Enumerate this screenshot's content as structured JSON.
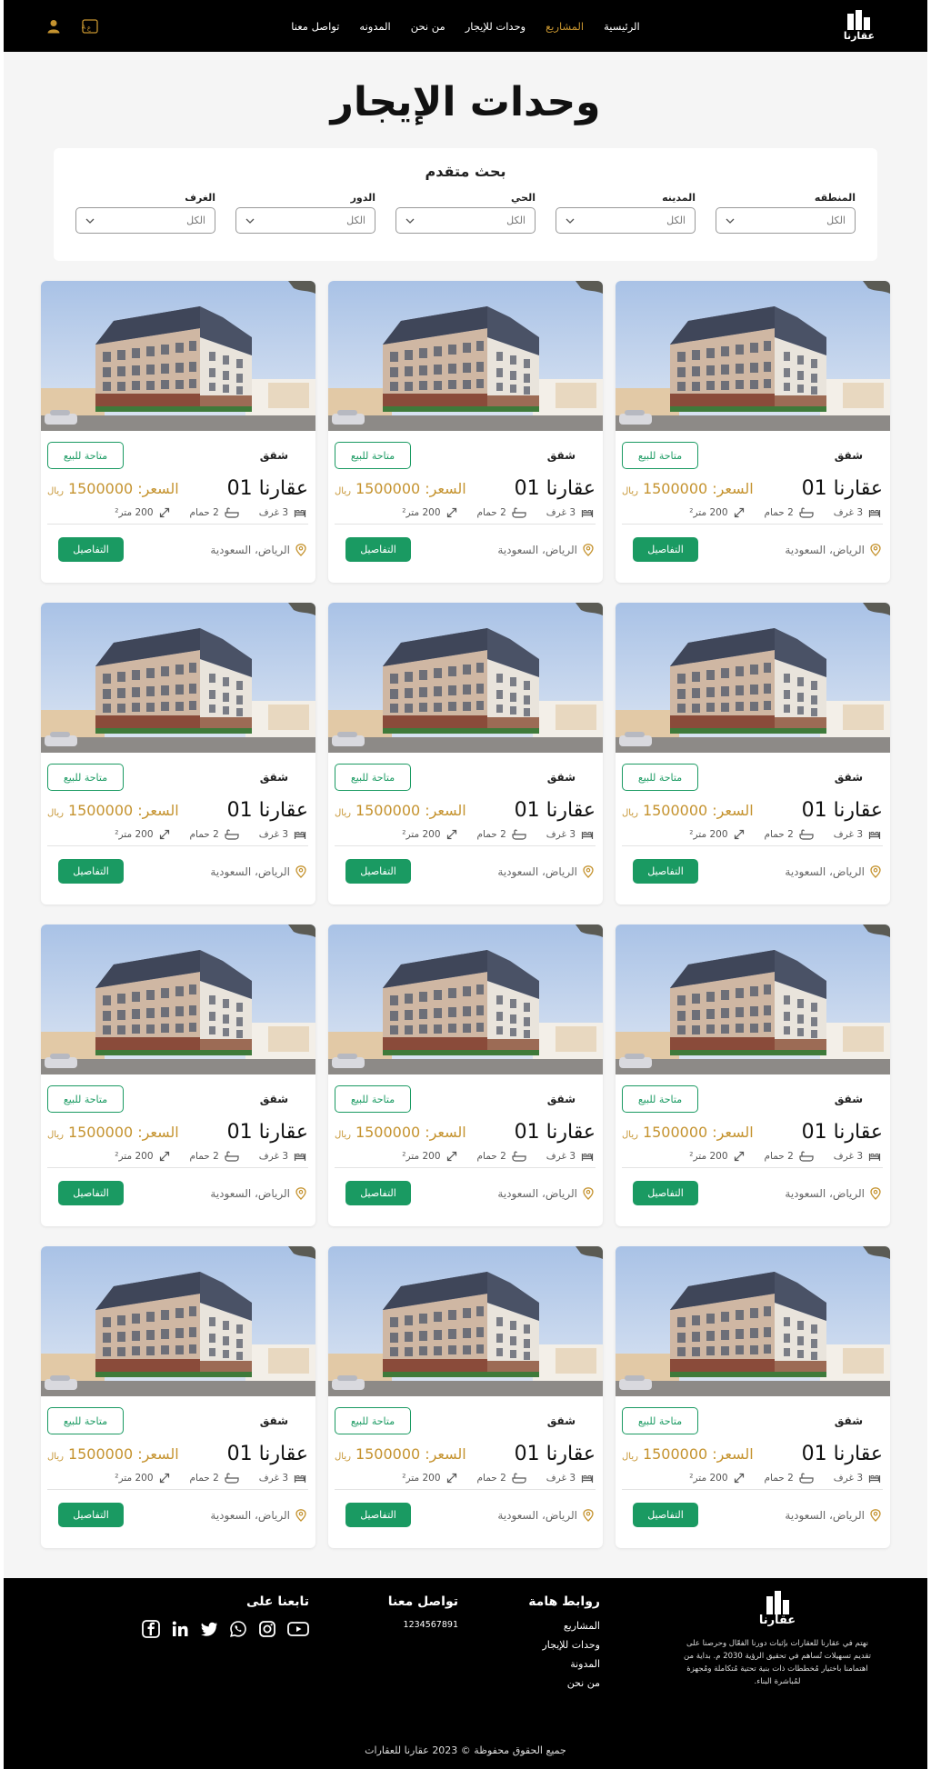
{
  "header": {
    "logo_text": "عقارنا",
    "nav": [
      {
        "label": "الرئيسية",
        "active": false
      },
      {
        "label": "المشاريع",
        "active": true
      },
      {
        "label": "وحدات للإيجار",
        "active": false
      },
      {
        "label": "من نحن",
        "active": false
      },
      {
        "label": "المدونه",
        "active": false
      },
      {
        "label": "تواصل معنا",
        "active": false
      }
    ],
    "icons": [
      "translate-icon",
      "user-icon"
    ]
  },
  "page_title": "وحدات الإيجار",
  "search": {
    "title": "بحث متقدم",
    "filters": [
      {
        "label": "المنطقه",
        "value": "الكل"
      },
      {
        "label": "المدينه",
        "value": "الكل"
      },
      {
        "label": "الحي",
        "value": "الكل"
      },
      {
        "label": "الدور",
        "value": "الكل"
      },
      {
        "label": "الغرف",
        "value": "الكل"
      }
    ]
  },
  "listings": [
    {
      "type": "شقق",
      "status": "متاحة للبيع",
      "name": "عقارنا 01",
      "price_label": "السعر:",
      "price": "1500000",
      "currency": "ريال",
      "rooms": "3 غرف",
      "baths": "2 حمام",
      "area": "200 متر²",
      "location": "الرياض، السعودية",
      "details": "التفاصيل"
    },
    {
      "type": "شقق",
      "status": "متاحة للبيع",
      "name": "عقارنا 01",
      "price_label": "السعر:",
      "price": "1500000",
      "currency": "ريال",
      "rooms": "3 غرف",
      "baths": "2 حمام",
      "area": "200 متر²",
      "location": "الرياض، السعودية",
      "details": "التفاصيل"
    },
    {
      "type": "شقق",
      "status": "متاحة للبيع",
      "name": "عقارنا 01",
      "price_label": "السعر:",
      "price": "1500000",
      "currency": "ريال",
      "rooms": "3 غرف",
      "baths": "2 حمام",
      "area": "200 متر²",
      "location": "الرياض، السعودية",
      "details": "التفاصيل"
    },
    {
      "type": "شقق",
      "status": "متاحة للبيع",
      "name": "عقارنا 01",
      "price_label": "السعر:",
      "price": "1500000",
      "currency": "ريال",
      "rooms": "3 غرف",
      "baths": "2 حمام",
      "area": "200 متر²",
      "location": "الرياض، السعودية",
      "details": "التفاصيل"
    },
    {
      "type": "شقق",
      "status": "متاحة للبيع",
      "name": "عقارنا 01",
      "price_label": "السعر:",
      "price": "1500000",
      "currency": "ريال",
      "rooms": "3 غرف",
      "baths": "2 حمام",
      "area": "200 متر²",
      "location": "الرياض، السعودية",
      "details": "التفاصيل"
    },
    {
      "type": "شقق",
      "status": "متاحة للبيع",
      "name": "عقارنا 01",
      "price_label": "السعر:",
      "price": "1500000",
      "currency": "ريال",
      "rooms": "3 غرف",
      "baths": "2 حمام",
      "area": "200 متر²",
      "location": "الرياض، السعودية",
      "details": "التفاصيل"
    },
    {
      "type": "شقق",
      "status": "متاحة للبيع",
      "name": "عقارنا 01",
      "price_label": "السعر:",
      "price": "1500000",
      "currency": "ريال",
      "rooms": "3 غرف",
      "baths": "2 حمام",
      "area": "200 متر²",
      "location": "الرياض، السعودية",
      "details": "التفاصيل"
    },
    {
      "type": "شقق",
      "status": "متاحة للبيع",
      "name": "عقارنا 01",
      "price_label": "السعر:",
      "price": "1500000",
      "currency": "ريال",
      "rooms": "3 غرف",
      "baths": "2 حمام",
      "area": "200 متر²",
      "location": "الرياض، السعودية",
      "details": "التفاصيل"
    },
    {
      "type": "شقق",
      "status": "متاحة للبيع",
      "name": "عقارنا 01",
      "price_label": "السعر:",
      "price": "1500000",
      "currency": "ريال",
      "rooms": "3 غرف",
      "baths": "2 حمام",
      "area": "200 متر²",
      "location": "الرياض، السعودية",
      "details": "التفاصيل"
    },
    {
      "type": "شقق",
      "status": "متاحة للبيع",
      "name": "عقارنا 01",
      "price_label": "السعر:",
      "price": "1500000",
      "currency": "ريال",
      "rooms": "3 غرف",
      "baths": "2 حمام",
      "area": "200 متر²",
      "location": "الرياض، السعودية",
      "details": "التفاصيل"
    },
    {
      "type": "شقق",
      "status": "متاحة للبيع",
      "name": "عقارنا 01",
      "price_label": "السعر:",
      "price": "1500000",
      "currency": "ريال",
      "rooms": "3 غرف",
      "baths": "2 حمام",
      "area": "200 متر²",
      "location": "الرياض، السعودية",
      "details": "التفاصيل"
    },
    {
      "type": "شقق",
      "status": "متاحة للبيع",
      "name": "عقارنا 01",
      "price_label": "السعر:",
      "price": "1500000",
      "currency": "ريال",
      "rooms": "3 غرف",
      "baths": "2 حمام",
      "area": "200 متر²",
      "location": "الرياض، السعودية",
      "details": "التفاصيل"
    }
  ],
  "footer": {
    "logo_text": "عقارنا",
    "about": "نهتم في عقارنا للعقارات بإثبات دورنا الفعّال وحرصنا على تقديم تسهيلات تُساهم في تحقيق الرؤية 2030 م. بداية من اهتمامنا باختيار مُخططات ذات بنية تحتية مُتكاملة ومُجهزة لمُباشرة البناء.",
    "links_title": "روابط هامة",
    "links": [
      "المشاريع",
      "وحدات للإيجار",
      "المدونة",
      "من نحن"
    ],
    "contact_title": "تواصل معنا",
    "phone": "1234567891",
    "follow_title": "تابعنا على",
    "socials": [
      "facebook-icon",
      "linkedin-icon",
      "twitter-icon",
      "whatsapp-icon",
      "instagram-icon",
      "youtube-icon"
    ],
    "copyright": "جميع الحقوق محفوظة © 2023 عقارنا للعقارات"
  },
  "colors": {
    "accent_gold": "#c5932f",
    "brand_green": "#1a9a62",
    "header_bg": "#000000"
  }
}
